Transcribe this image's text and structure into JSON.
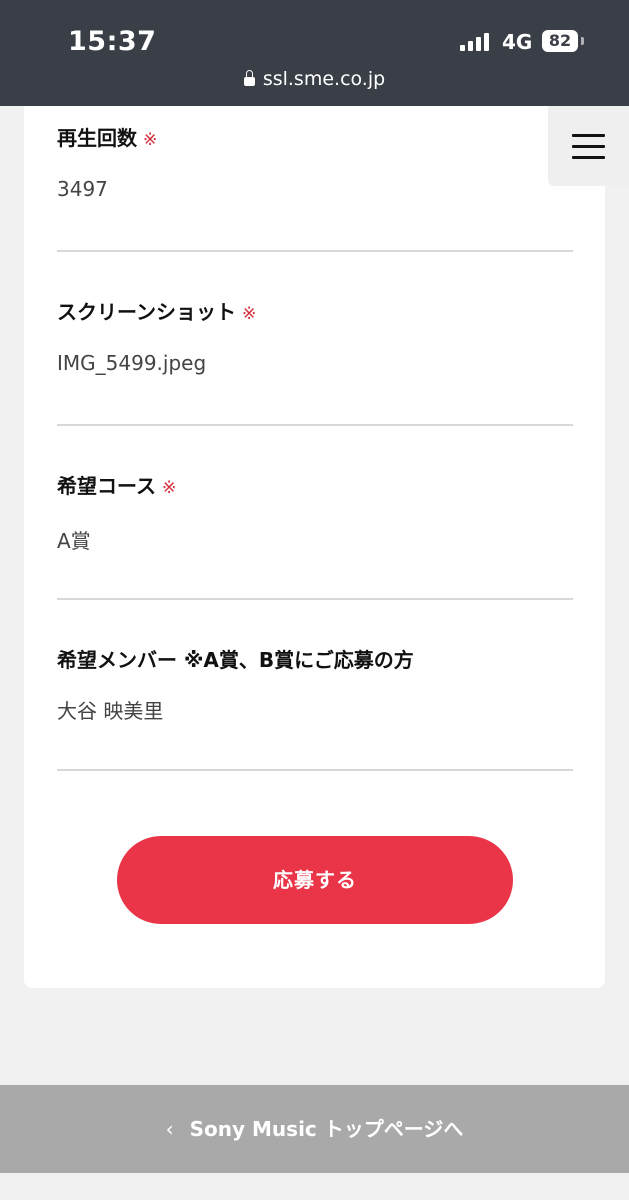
{
  "status_bar": {
    "time": "15:37",
    "network": "4G",
    "battery": "82",
    "url": "ssl.sme.co.jp"
  },
  "form": {
    "fields": [
      {
        "label": "再生回数",
        "required_mark": "※",
        "value": "3497"
      },
      {
        "label": "スクリーンショット",
        "required_mark": "※",
        "value": "IMG_5499.jpeg"
      },
      {
        "label": "希望コース",
        "required_mark": "※",
        "value": "A賞"
      },
      {
        "label": "希望メンバー ※A賞、B賞にご応募の方",
        "value": "大谷 映美里"
      }
    ],
    "submit_label": "応募する"
  },
  "footer": {
    "chevron": "‹",
    "link_label": "Sony Music トップページへ"
  },
  "icons": {
    "menu": "hamburger-icon",
    "lock": "lock-icon",
    "signal": "cellular-signal-icon",
    "battery": "battery-icon",
    "back": "chevron-left-icon"
  },
  "colors": {
    "status_bar_bg": "#3a3f47",
    "accent": "#ea3447",
    "required": "#d62d3b",
    "footer_bg": "#a9a9a9",
    "page_bg": "#f1f1f1"
  }
}
